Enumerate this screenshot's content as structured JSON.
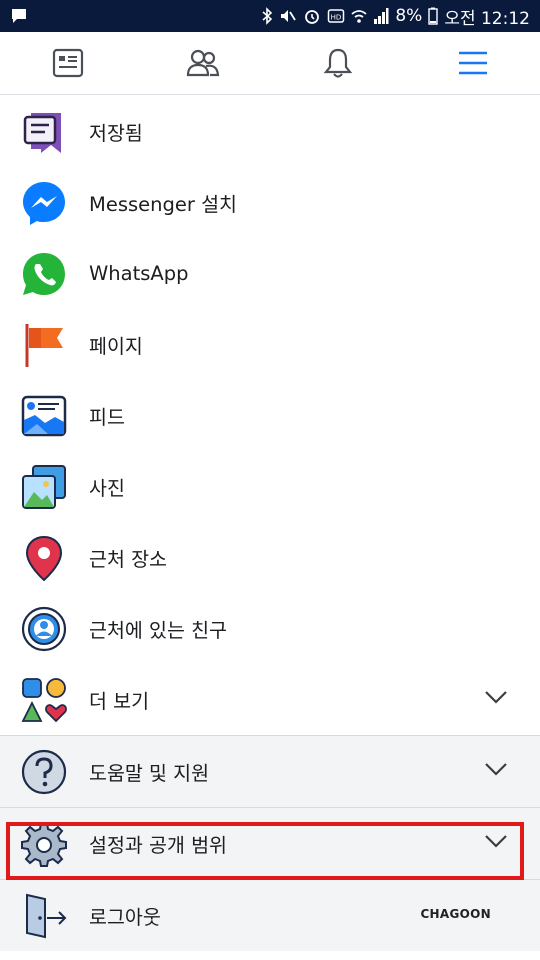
{
  "status_bar": {
    "battery": "8%",
    "time": "오전 12:12"
  },
  "tabs": [
    {
      "name": "news-feed-icon",
      "active": false
    },
    {
      "name": "friends-icon",
      "active": false
    },
    {
      "name": "notifications-icon",
      "active": false
    },
    {
      "name": "menu-icon",
      "active": true
    }
  ],
  "menu": {
    "items": [
      {
        "label": "저장됨",
        "icon": "saved-icon"
      },
      {
        "label": "Messenger 설치",
        "icon": "messenger-icon"
      },
      {
        "label": "WhatsApp",
        "icon": "whatsapp-icon"
      },
      {
        "label": "페이지",
        "icon": "flag-icon"
      },
      {
        "label": "피드",
        "icon": "feed-icon"
      },
      {
        "label": "사진",
        "icon": "photos-icon"
      },
      {
        "label": "근처 장소",
        "icon": "map-pin-icon"
      },
      {
        "label": "근처에 있는 친구",
        "icon": "nearby-friends-icon"
      },
      {
        "label": "더 보기",
        "icon": "shapes-icon"
      }
    ],
    "sections": [
      {
        "label": "도움말 및 지원",
        "icon": "help-icon"
      },
      {
        "label": "설정과 공개 범위",
        "icon": "gear-icon"
      },
      {
        "label": "로그아웃",
        "icon": "logout-icon"
      }
    ]
  },
  "watermark": "CHAGOON",
  "colors": {
    "status_bar": "#0a1a3c",
    "accent": "#1877f2",
    "highlight": "#e01a1a"
  }
}
